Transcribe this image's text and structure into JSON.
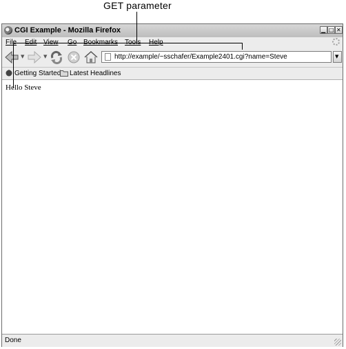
{
  "annotation": {
    "label": "GET parameter"
  },
  "window": {
    "title": "CGI Example - Mozilla Firefox"
  },
  "menu": [
    "File",
    "Edit",
    "View",
    "Go",
    "Bookmarks",
    "Tools",
    "Help"
  ],
  "navigation": {
    "url": "http://example/~sschafer/Example2401.cgi?name=Steve"
  },
  "bookmarks": [
    "Getting Started",
    "Latest Headlines"
  ],
  "content": {
    "text": "Hello Steve"
  },
  "status": {
    "text": "Done"
  }
}
